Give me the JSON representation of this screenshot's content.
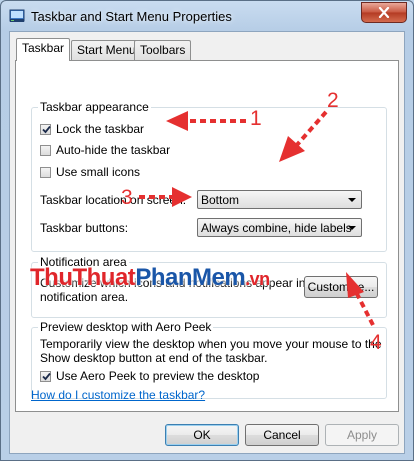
{
  "window": {
    "title": "Taskbar and Start Menu Properties"
  },
  "tabs": [
    {
      "label": "Taskbar",
      "active": true
    },
    {
      "label": "Start Menu",
      "active": false
    },
    {
      "label": "Toolbars",
      "active": false
    }
  ],
  "appearance": {
    "title": "Taskbar appearance",
    "lock_label": "Lock the taskbar",
    "lock_checked": true,
    "autohide_label": "Auto-hide the taskbar",
    "autohide_checked": false,
    "small_icons_label": "Use small icons",
    "small_icons_checked": false,
    "location_label": "Taskbar location on screen:",
    "location_value": "Bottom",
    "buttons_label": "Taskbar buttons:",
    "buttons_value": "Always combine, hide labels"
  },
  "notification": {
    "title": "Notification area",
    "text_line1": "Customize which icons and notifications appear in the",
    "text_line2": "notification area.",
    "customize_label": "Customize..."
  },
  "peek": {
    "title": "Preview desktop with Aero Peek",
    "text_line1": "Temporarily view the desktop when you move your mouse to the",
    "text_line2": "Show desktop button at end of the taskbar.",
    "checkbox_label": "Use Aero Peek to preview the desktop",
    "checked": true
  },
  "help_link": "How do I customize the taskbar?",
  "buttons": {
    "ok": "OK",
    "cancel": "Cancel",
    "apply": "Apply"
  },
  "annotations": {
    "n1": "1",
    "n2": "2",
    "n3": "3",
    "n4": "4"
  },
  "watermark": {
    "part1": "ThuThuat",
    "part2": "PhanMem",
    "part3": ".vn"
  },
  "colors": {
    "annotation": "#e53030",
    "link": "#0066cc",
    "close": "#c8563f"
  }
}
